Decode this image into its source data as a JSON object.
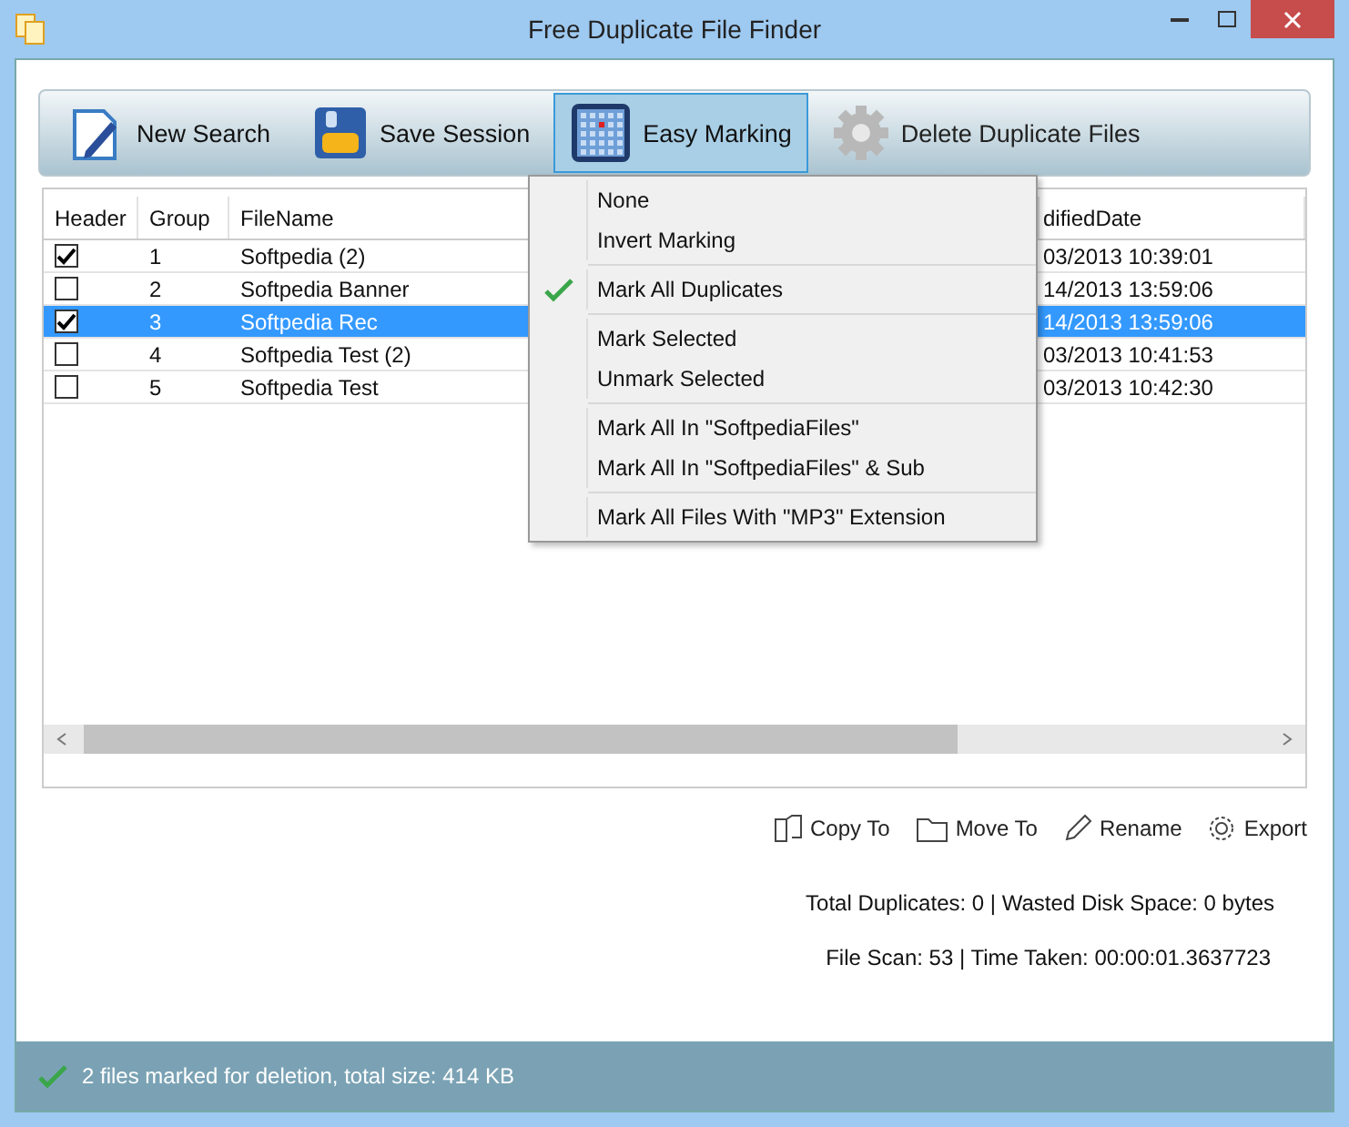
{
  "window": {
    "title": "Free Duplicate File Finder"
  },
  "toolbar": [
    {
      "kind": "new",
      "label": "New Search",
      "selected": false,
      "disabled": false
    },
    {
      "kind": "save",
      "label": "Save Session",
      "selected": false,
      "disabled": false
    },
    {
      "kind": "mark",
      "label": "Easy Marking",
      "selected": true,
      "disabled": false
    },
    {
      "kind": "delete",
      "label": "Delete Duplicate Files",
      "selected": false,
      "disabled": true
    }
  ],
  "table": {
    "columns": [
      "Header",
      "Group",
      "FileName",
      "difiedDate"
    ],
    "rows": [
      {
        "checked": true,
        "selected": false,
        "group": "1",
        "filename": "Softpedia (2)",
        "date": "03/2013 10:39:01"
      },
      {
        "checked": false,
        "selected": false,
        "group": "2",
        "filename": "Softpedia Banner",
        "date": "14/2013 13:59:06"
      },
      {
        "checked": true,
        "selected": true,
        "group": "3",
        "filename": "Softpedia Rec",
        "date": "14/2013 13:59:06"
      },
      {
        "checked": false,
        "selected": false,
        "group": "4",
        "filename": "Softpedia Test (2)",
        "date": "03/2013 10:41:53"
      },
      {
        "checked": false,
        "selected": false,
        "group": "5",
        "filename": "Softpedia Test",
        "date": "03/2013 10:42:30"
      }
    ]
  },
  "menu": {
    "groups": [
      [
        {
          "label": "None",
          "checked": false
        },
        {
          "label": "Invert Marking",
          "checked": false
        }
      ],
      [
        {
          "label": "Mark All Duplicates",
          "checked": true
        }
      ],
      [
        {
          "label": "Mark Selected",
          "checked": false
        },
        {
          "label": "Unmark Selected",
          "checked": false
        }
      ],
      [
        {
          "label": "Mark All In \"SoftpediaFiles\"",
          "checked": false
        },
        {
          "label": "Mark All In \"SoftpediaFiles\" & Sub",
          "checked": false
        }
      ],
      [
        {
          "label": "Mark All Files With \"MP3\" Extension",
          "checked": false
        }
      ]
    ]
  },
  "actions": [
    {
      "kind": "copy",
      "label": "Copy To"
    },
    {
      "kind": "move",
      "label": "Move To"
    },
    {
      "kind": "rename",
      "label": "Rename"
    },
    {
      "kind": "export",
      "label": "Export"
    }
  ],
  "stats": [
    "Total Duplicates:  0 | Wasted Disk Space: 0 bytes",
    "File Scan:  53 | Time Taken: 00:00:01.3637723"
  ],
  "status_bar": {
    "text": "2 files marked for deletion, total size: 414 KB"
  }
}
